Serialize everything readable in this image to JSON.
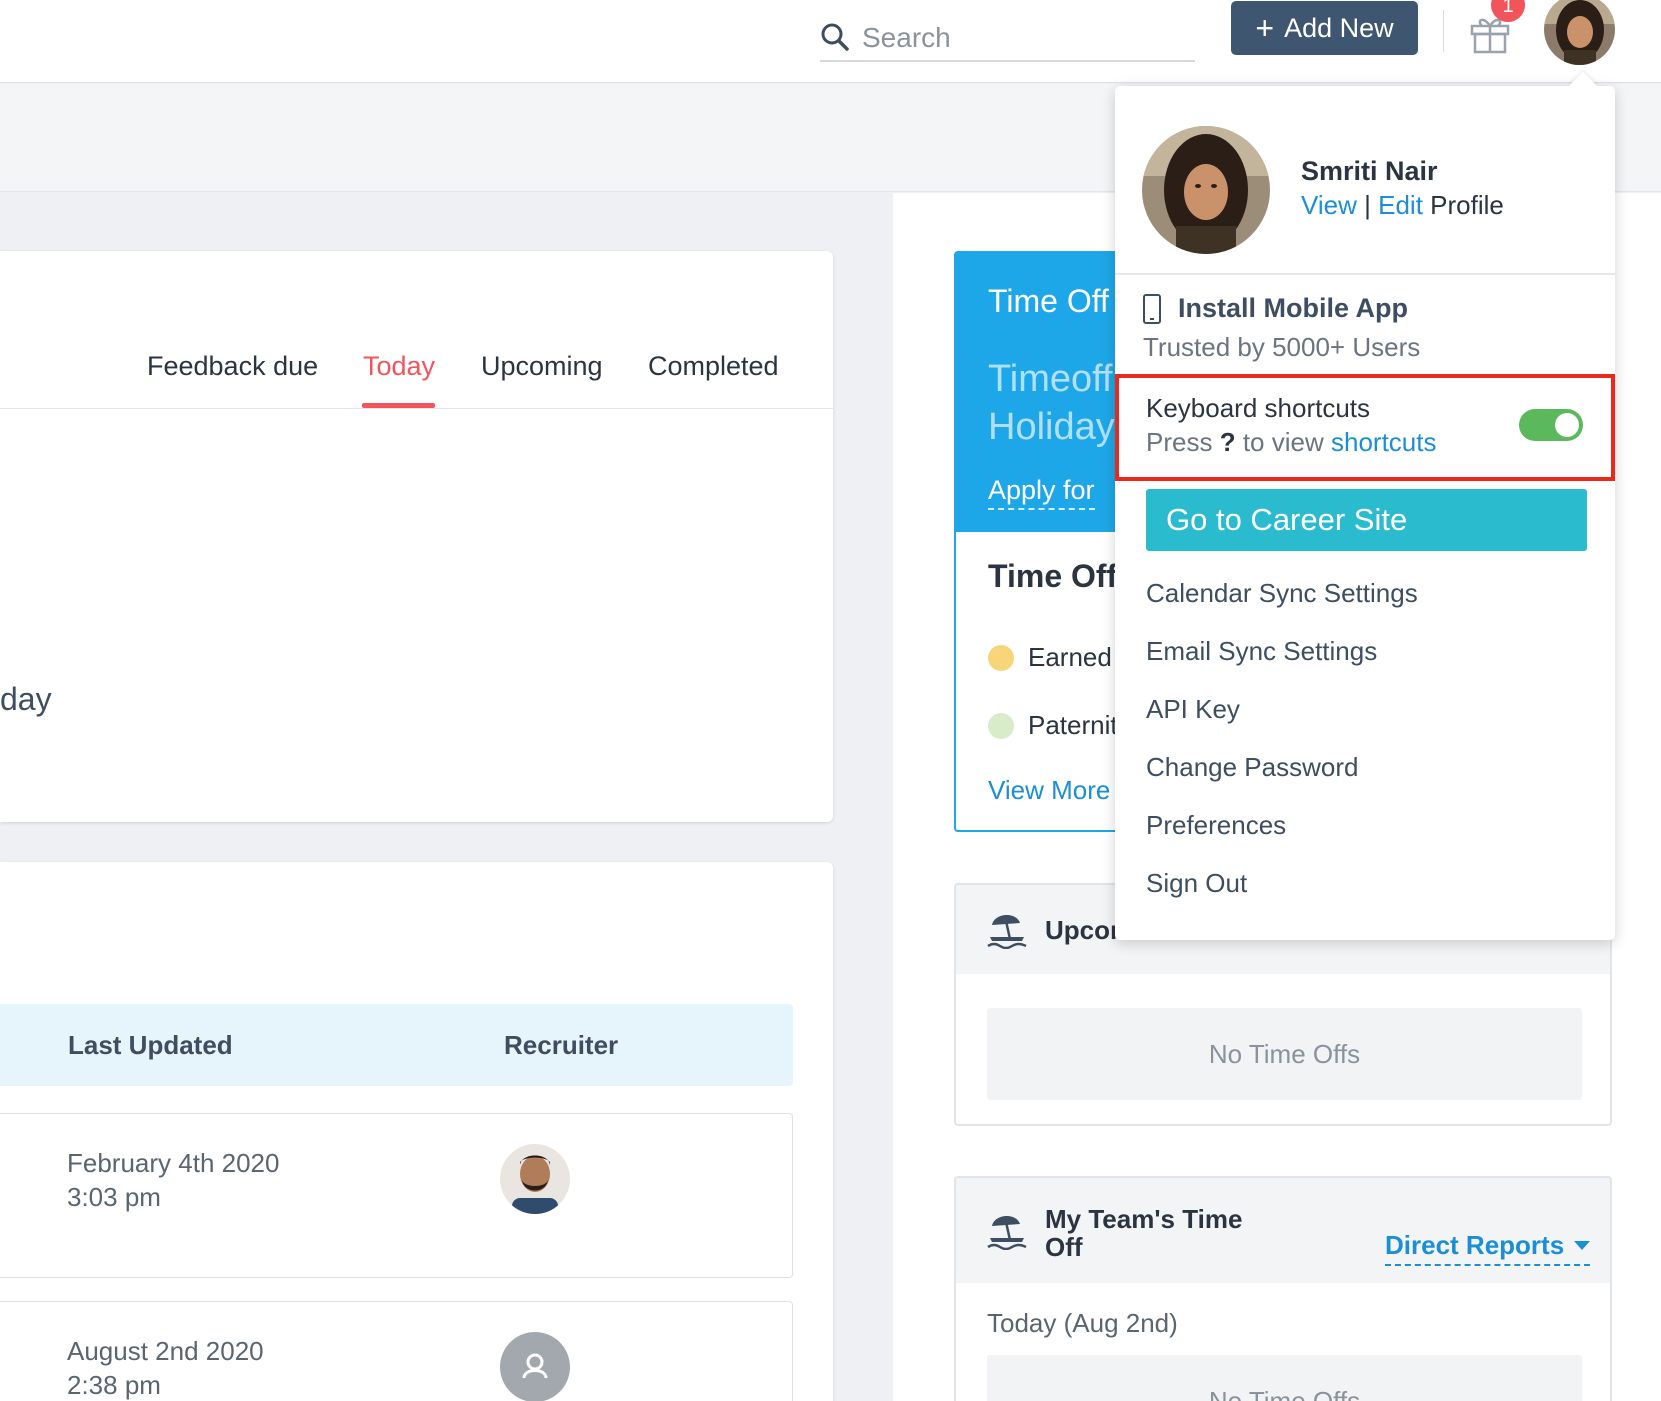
{
  "topbar": {
    "search_placeholder": "Search",
    "add_new_label": "Add New",
    "add_new_icon": "plus-icon",
    "gift_badge_count": "1",
    "gift_icon": "gift-icon"
  },
  "tabs": [
    {
      "label": "Feedback due",
      "active": false
    },
    {
      "label": "Today",
      "active": true
    },
    {
      "label": "Upcoming",
      "active": false
    },
    {
      "label": "Completed",
      "active": false
    }
  ],
  "left_card": {
    "partial_text": "day"
  },
  "table": {
    "headers": [
      "Last Updated",
      "Recruiter"
    ],
    "rows": [
      {
        "date": "February 4th 2020",
        "time": "3:03 pm",
        "recruiter_avatar": "photo"
      },
      {
        "date": "August 2nd 2020",
        "time": "2:38 pm",
        "recruiter_avatar": "placeholder"
      }
    ]
  },
  "time_off_card": {
    "title": "Time Off",
    "big_line1": "Timeoff",
    "big_line2": "Holiday",
    "apply_link": "Apply for",
    "subtitle": "Time Off",
    "legend": [
      {
        "label": "Earned",
        "color": "#f9d57a"
      },
      {
        "label": "Paternit",
        "color": "#d9ecc9"
      }
    ],
    "view_more": "View More"
  },
  "upcoming_panel": {
    "title": "Upcoı",
    "empty_text": "No Time Offs"
  },
  "team_panel": {
    "title_line1": "My Team's Time",
    "title_line2": "Off",
    "filter_label": "Direct Reports",
    "today_label": "Today (Aug 2nd)",
    "empty_text": "No Time Offs"
  },
  "profile_menu": {
    "name": "Smriti Nair",
    "view_link": "View",
    "separator": "|",
    "edit_link": "Edit",
    "profile_word": "Profile",
    "install_app": "Install Mobile App",
    "trusted": "Trusted by 5000+ Users",
    "keyboard_title": "Keyboard shortcuts",
    "keyboard_press": "Press",
    "keyboard_key": "?",
    "keyboard_to_view": "to view",
    "keyboard_link": "shortcuts",
    "keyboard_enabled": true,
    "career_button": "Go to Career Site",
    "items": [
      "Calendar Sync Settings",
      "Email Sync Settings",
      "API Key",
      "Change Password",
      "Preferences",
      "Sign Out"
    ]
  },
  "colors": {
    "accent_red": "#f2545b",
    "brand_dark": "#3e5670",
    "time_off_blue": "#1ea7e8",
    "career_teal": "#2bbbce",
    "toggle_green": "#5cb85c",
    "link_blue": "#1b8fd6",
    "highlight_red": "#e8291c"
  }
}
